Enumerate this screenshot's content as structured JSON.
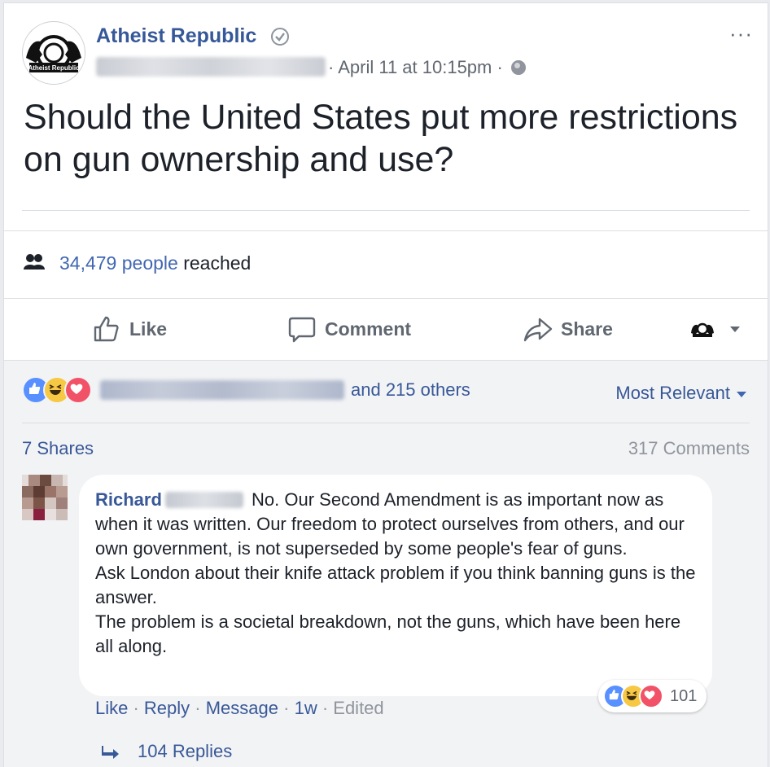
{
  "post": {
    "page_name": "Atheist Republic",
    "logo_text": "Atheist Republic",
    "date": "· April 11 at 10:15pm ·",
    "more": "···",
    "text": "Should the United States put more restrictions on gun ownership and use?"
  },
  "reach": {
    "count": "34,479 people",
    "suffix": " reached"
  },
  "actions": {
    "like": "Like",
    "comment": "Comment",
    "share": "Share"
  },
  "reactions": {
    "others": "and 215 others",
    "sort": "Most Relevant"
  },
  "counts": {
    "shares": "7 Shares",
    "comments": "317 Comments"
  },
  "comment": {
    "author": "Richard",
    "lines": [
      "No. Our Second Amendment is as important now as when it was written. Our freedom to protect ourselves from others, and our own government, is not superseded by some people's fear of guns.",
      "Ask London about their knife attack problem if you think banning guns is the answer.",
      "The problem is a societal breakdown, not the guns, which have been here all along."
    ],
    "like": "Like",
    "reply": "Reply",
    "message": "Message",
    "time": "1w",
    "edited": "Edited",
    "reaction_count": "101",
    "replies": "104 Replies"
  },
  "colors": {
    "link": "#385898",
    "like": "#5890ff",
    "haha": "#f7c843",
    "love": "#f25268"
  },
  "icons": [
    "verified-icon",
    "globe-icon",
    "people-icon",
    "like-icon",
    "comment-icon",
    "share-icon",
    "reply-arrow-icon"
  ]
}
